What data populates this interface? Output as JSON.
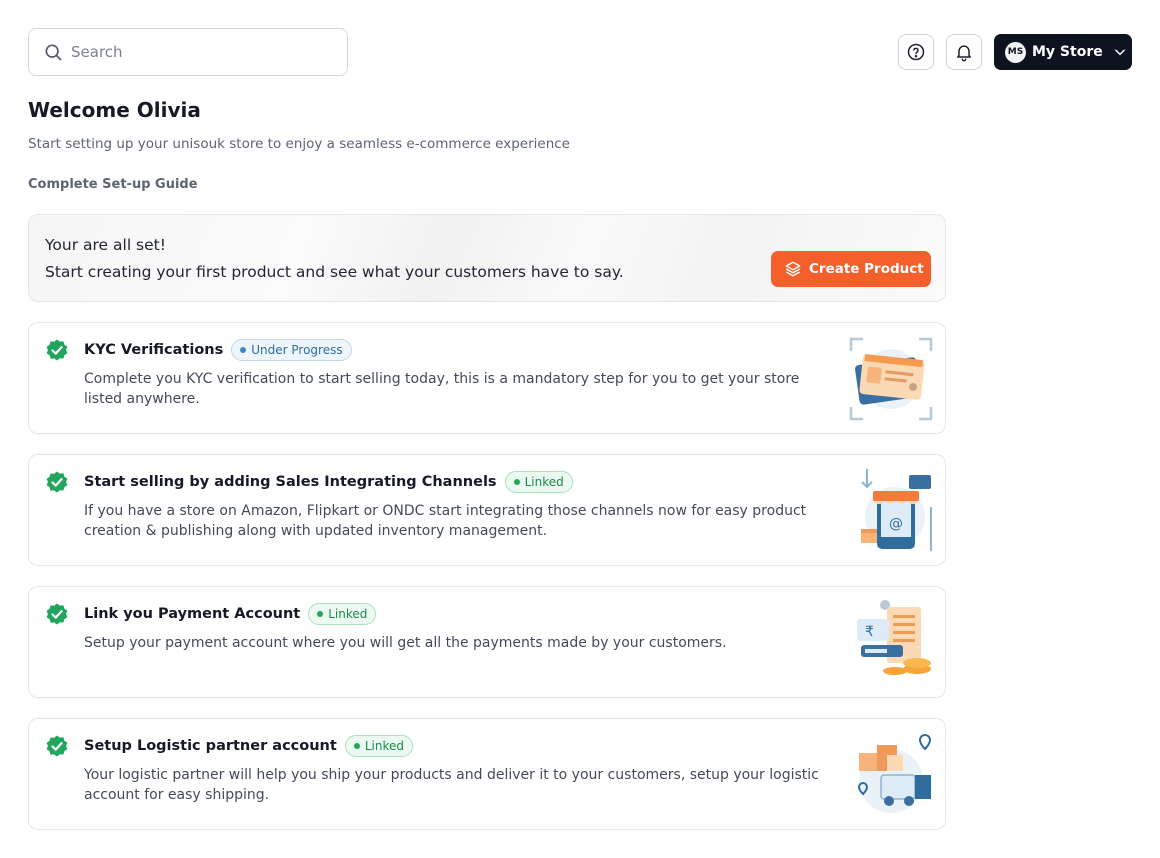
{
  "header": {
    "search_placeholder": "Search",
    "store_initials": "MS",
    "store_name": "My Store"
  },
  "welcome": {
    "title": "Welcome Olivia",
    "subtitle": "Start setting up your unisouk store to enjoy a seamless e-commerce experience",
    "guide_title": "Complete Set-up Guide"
  },
  "allset": {
    "line1": "Your are all set!",
    "line2": "Start creating your first product and see what your customers have to say.",
    "button": "Create Product"
  },
  "steps": [
    {
      "title": "KYC Verifications",
      "badge": "Under Progress",
      "description": "Complete you KYC verification to start selling today, this is a mandatory step for you to get your store listed anywhere.",
      "illustration": "identity-card-icon"
    },
    {
      "title": "Start selling by adding Sales Integrating Channels",
      "badge": "Linked",
      "description": "If you have a store on Amazon, Flipkart or ONDC start integrating those channels now for easy product creation & publishing along with updated inventory management.",
      "illustration": "online-store-icon"
    },
    {
      "title": "Link you Payment Account",
      "badge": "Linked",
      "description": "Setup your payment account where you will get all the payments made by your customers.",
      "illustration": "payment-invoice-icon"
    },
    {
      "title": "Setup Logistic partner account",
      "badge": "Linked",
      "description": "Your logistic partner will help you ship your products and deliver it to your customers, setup your logistic account for easy shipping.",
      "illustration": "delivery-truck-icon"
    }
  ],
  "colors": {
    "accent": "#f45f2c",
    "dark": "#0e1320",
    "success": "#22a65d",
    "info": "#3f86c4"
  }
}
